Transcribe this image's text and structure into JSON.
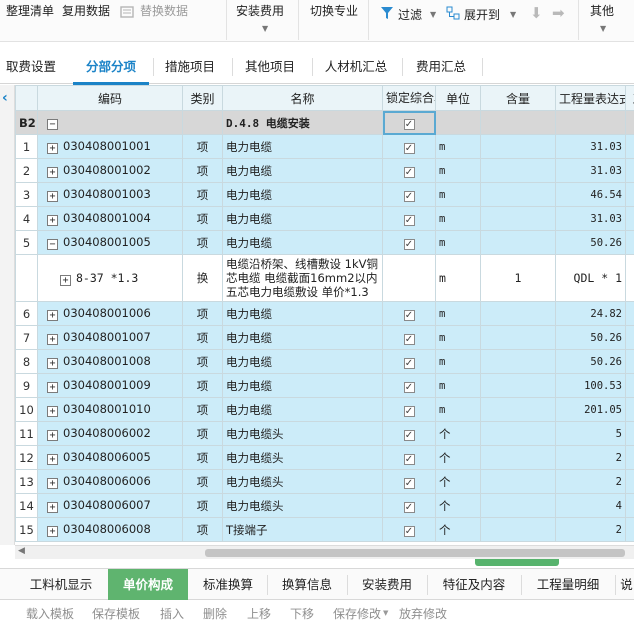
{
  "toolbar": {
    "organize_list": "整理清单",
    "reuse_data": "复用数据",
    "replace_data": "替换数据",
    "install_fee": "安装费用",
    "switch_major": "切换专业",
    "filter": "过滤",
    "expand_to": "展开到",
    "other": "其他"
  },
  "tabs": [
    "取费设置",
    "分部分项",
    "措施项目",
    "其他项目",
    "人材机汇总",
    "费用汇总"
  ],
  "columns": {
    "code": "编码",
    "type": "类别",
    "name": "名称",
    "lock_price": "锁定综合单价",
    "unit": "单位",
    "content": "含量",
    "quantity_expr": "工程量表达式",
    "more": "工"
  },
  "group": {
    "num": "B2",
    "name": "D.4.8 电缆安装"
  },
  "rows": [
    {
      "num": "1",
      "code": "030408001001",
      "type": "项",
      "name": "电力电缆",
      "unit": "m",
      "qty": "31.03"
    },
    {
      "num": "2",
      "code": "030408001002",
      "type": "项",
      "name": "电力电缆",
      "unit": "m",
      "qty": "31.03"
    },
    {
      "num": "3",
      "code": "030408001003",
      "type": "项",
      "name": "电力电缆",
      "unit": "m",
      "qty": "46.54"
    },
    {
      "num": "4",
      "code": "030408001004",
      "type": "项",
      "name": "电力电缆",
      "unit": "m",
      "qty": "31.03"
    },
    {
      "num": "5",
      "code": "030408001005",
      "type": "项",
      "name": "电力电缆",
      "unit": "m",
      "qty": "50.26"
    },
    {
      "num": "6",
      "code": "030408001006",
      "type": "项",
      "name": "电力电缆",
      "unit": "m",
      "qty": "24.82"
    },
    {
      "num": "7",
      "code": "030408001007",
      "type": "项",
      "name": "电力电缆",
      "unit": "m",
      "qty": "50.26"
    },
    {
      "num": "8",
      "code": "030408001008",
      "type": "项",
      "name": "电力电缆",
      "unit": "m",
      "qty": "50.26"
    },
    {
      "num": "9",
      "code": "030408001009",
      "type": "项",
      "name": "电力电缆",
      "unit": "m",
      "qty": "100.53"
    },
    {
      "num": "10",
      "code": "030408001010",
      "type": "项",
      "name": "电力电缆",
      "unit": "m",
      "qty": "201.05"
    },
    {
      "num": "11",
      "code": "030408006002",
      "type": "项",
      "name": "电力电缆头",
      "unit": "个",
      "qty": "5"
    },
    {
      "num": "12",
      "code": "030408006005",
      "type": "项",
      "name": "电力电缆头",
      "unit": "个",
      "qty": "2"
    },
    {
      "num": "13",
      "code": "030408006006",
      "type": "项",
      "name": "电力电缆头",
      "unit": "个",
      "qty": "2"
    },
    {
      "num": "14",
      "code": "030408006007",
      "type": "项",
      "name": "电力电缆头",
      "unit": "个",
      "qty": "4"
    },
    {
      "num": "15",
      "code": "030408006008",
      "type": "项",
      "name": "T接端子",
      "unit": "个",
      "qty": "2"
    }
  ],
  "subrow": {
    "code": "8-37 *1.3",
    "type": "换",
    "name_lines": [
      "电缆沿桥架、线槽敷设 1kV铜",
      "芯电缆 电缆截面16mm2以内",
      "五芯电力电缆敷设 单价*1.3"
    ],
    "unit": "m",
    "content": "1",
    "qty": "QDL * 1"
  },
  "bottom_tabs": [
    "工料机显示",
    "单价构成",
    "标准换算",
    "换算信息",
    "安装费用",
    "特征及内容",
    "工程量明细",
    "说"
  ],
  "actions": [
    "载入模板",
    "保存模板",
    "插入",
    "删除",
    "上移",
    "下移",
    "保存修改",
    "放弃修改"
  ]
}
